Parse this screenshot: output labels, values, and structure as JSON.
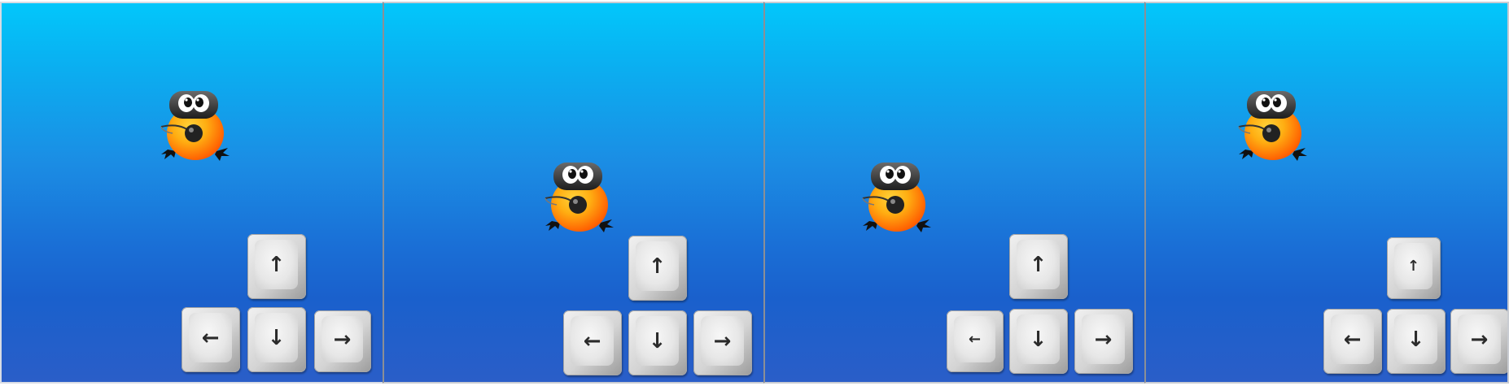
{
  "scene": {
    "colors": {
      "sky_top": "#02c7fb",
      "sky_bottom": "#2a5ec8",
      "bird_body": "#ff8a00",
      "bird_goggles": "#3a3a3a",
      "key_face": "#e6e6e6"
    },
    "panels": [
      {
        "keys": {
          "up": "↑",
          "left": "←",
          "down": "↓",
          "right": "→"
        }
      },
      {
        "keys": {
          "up": "↑",
          "left": "←",
          "down": "↓",
          "right": "→"
        }
      },
      {
        "keys": {
          "up": "↑",
          "left": "←",
          "down": "↓",
          "right": "→"
        }
      },
      {
        "keys": {
          "up": "↑",
          "left": "←",
          "down": "↓",
          "right": "→"
        }
      }
    ]
  }
}
